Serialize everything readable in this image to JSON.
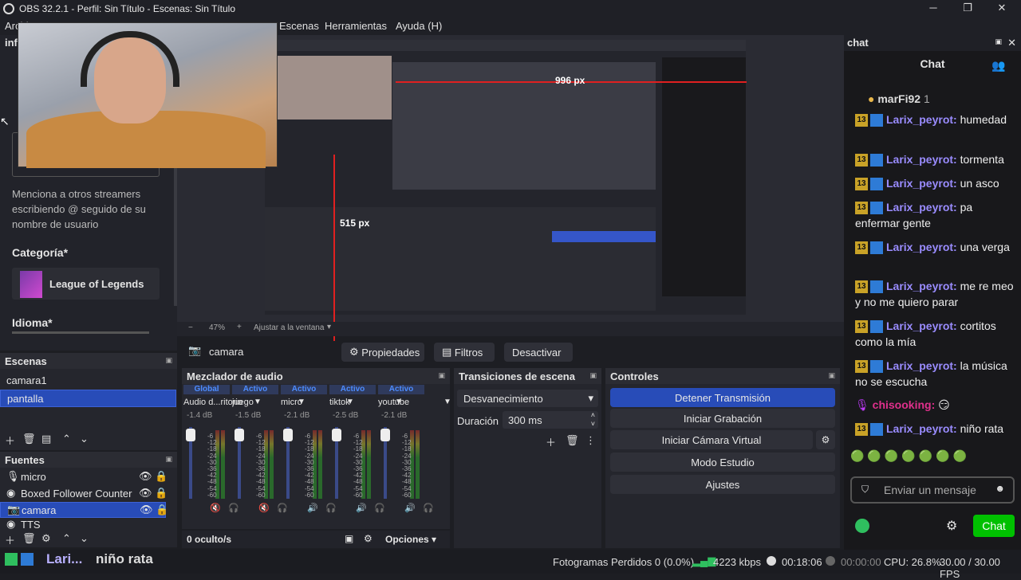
{
  "window": {
    "title": "OBS 32.2.1 - Perfil: Sin Título - Escenas: Sin Título"
  },
  "menu": {
    "items": [
      "Archivo",
      "Escenas",
      "Herramientas",
      "Ayuda (H)"
    ]
  },
  "info": {
    "header_partial": "inf",
    "mention_hint": "Menciona a otros streamers escribiendo @ seguido de su nombre de usuario",
    "category_label": "Categoría*",
    "category_value": "League of Legends",
    "language_label": "Idioma*"
  },
  "preview": {
    "zoom": "47%",
    "fit_label": "Ajustar a la ventana",
    "dim_h": "996 px",
    "dim_v": "515 px"
  },
  "source_toolbar": {
    "source": "camara",
    "properties": "Propiedades",
    "filters": "Filtros",
    "deactivate": "Desactivar"
  },
  "scenes": {
    "title": "Escenas",
    "items": [
      "camara1",
      "pantalla"
    ],
    "selected": "pantalla"
  },
  "sources": {
    "title": "Fuentes",
    "items": [
      "micro",
      "Boxed Follower Counter",
      "camara",
      "TTS"
    ],
    "selected": "camara"
  },
  "mixer": {
    "title": "Mezclador de audio",
    "hidden": "0 oculto/s",
    "options": "Opciones",
    "channels": [
      {
        "tag": "Global",
        "name": "Audio d...ritorio",
        "db": "-1.4 dB"
      },
      {
        "tag": "Activo",
        "name": "juego",
        "db": "-1.5 dB"
      },
      {
        "tag": "Activo",
        "name": "micro",
        "db": "-2.1 dB"
      },
      {
        "tag": "Activo",
        "name": "tiktok",
        "db": "-2.5 dB"
      },
      {
        "tag": "Activo",
        "name": "youtube",
        "db": "-2.1 dB"
      }
    ],
    "scale": [
      "-6",
      "-12",
      "-18",
      "-24",
      "-30",
      "-36",
      "-42",
      "-48",
      "-54",
      "-60"
    ]
  },
  "transitions": {
    "title": "Transiciones de escena",
    "type": "Desvanecimiento",
    "duration_label": "Duración",
    "duration": "300 ms"
  },
  "controls": {
    "title": "Controles",
    "buttons": [
      "Detener Transmisión",
      "Iniciar Grabación",
      "Iniciar Cámara Virtual",
      "Modo Estudio",
      "Ajustes"
    ]
  },
  "chat": {
    "dock_title": "chat",
    "header": "Chat",
    "top_user": "marFi92",
    "top_count": "1",
    "messages": [
      {
        "badge": "13",
        "user": "Larix_peyrot",
        "text": "humedad"
      },
      {
        "badge": "13",
        "user": "Larix_peyrot",
        "text": "tormenta"
      },
      {
        "badge": "13",
        "user": "Larix_peyrot",
        "text": "un asco"
      },
      {
        "badge": "13",
        "user": "Larix_peyrot",
        "text": "pa enfermar gente"
      },
      {
        "badge": "13",
        "user": "Larix_peyrot",
        "text": "una verga"
      },
      {
        "badge": "13",
        "user": "Larix_peyrot",
        "text": "me re meo y no me quiero parar"
      },
      {
        "badge": "13",
        "user": "Larix_peyrot",
        "text": "cortitos como la mía"
      },
      {
        "badge": "13",
        "user": "Larix_peyrot",
        "text": "la música no se escucha"
      },
      {
        "badge": "",
        "user": "chisooking",
        "text": ""
      },
      {
        "badge": "13",
        "user": "Larix_peyrot",
        "text": "niño rata"
      }
    ],
    "input_placeholder": "Enviar un mensaje",
    "send": "Chat"
  },
  "ticker": {
    "user": "Lari...",
    "text": "niño rata"
  },
  "status": {
    "dropped": "Fotogramas Perdidos 0 (0.0%)",
    "kbps": "4223 kbps",
    "stream_time": "00:18:06",
    "rec_time": "00:00:00",
    "cpu": "CPU: 26.8%",
    "fps": "30.00 / 30.00 FPS"
  },
  "colors": {
    "accent": "#284cb8",
    "chat_send": "#00c000",
    "username": "#9a8cff"
  }
}
